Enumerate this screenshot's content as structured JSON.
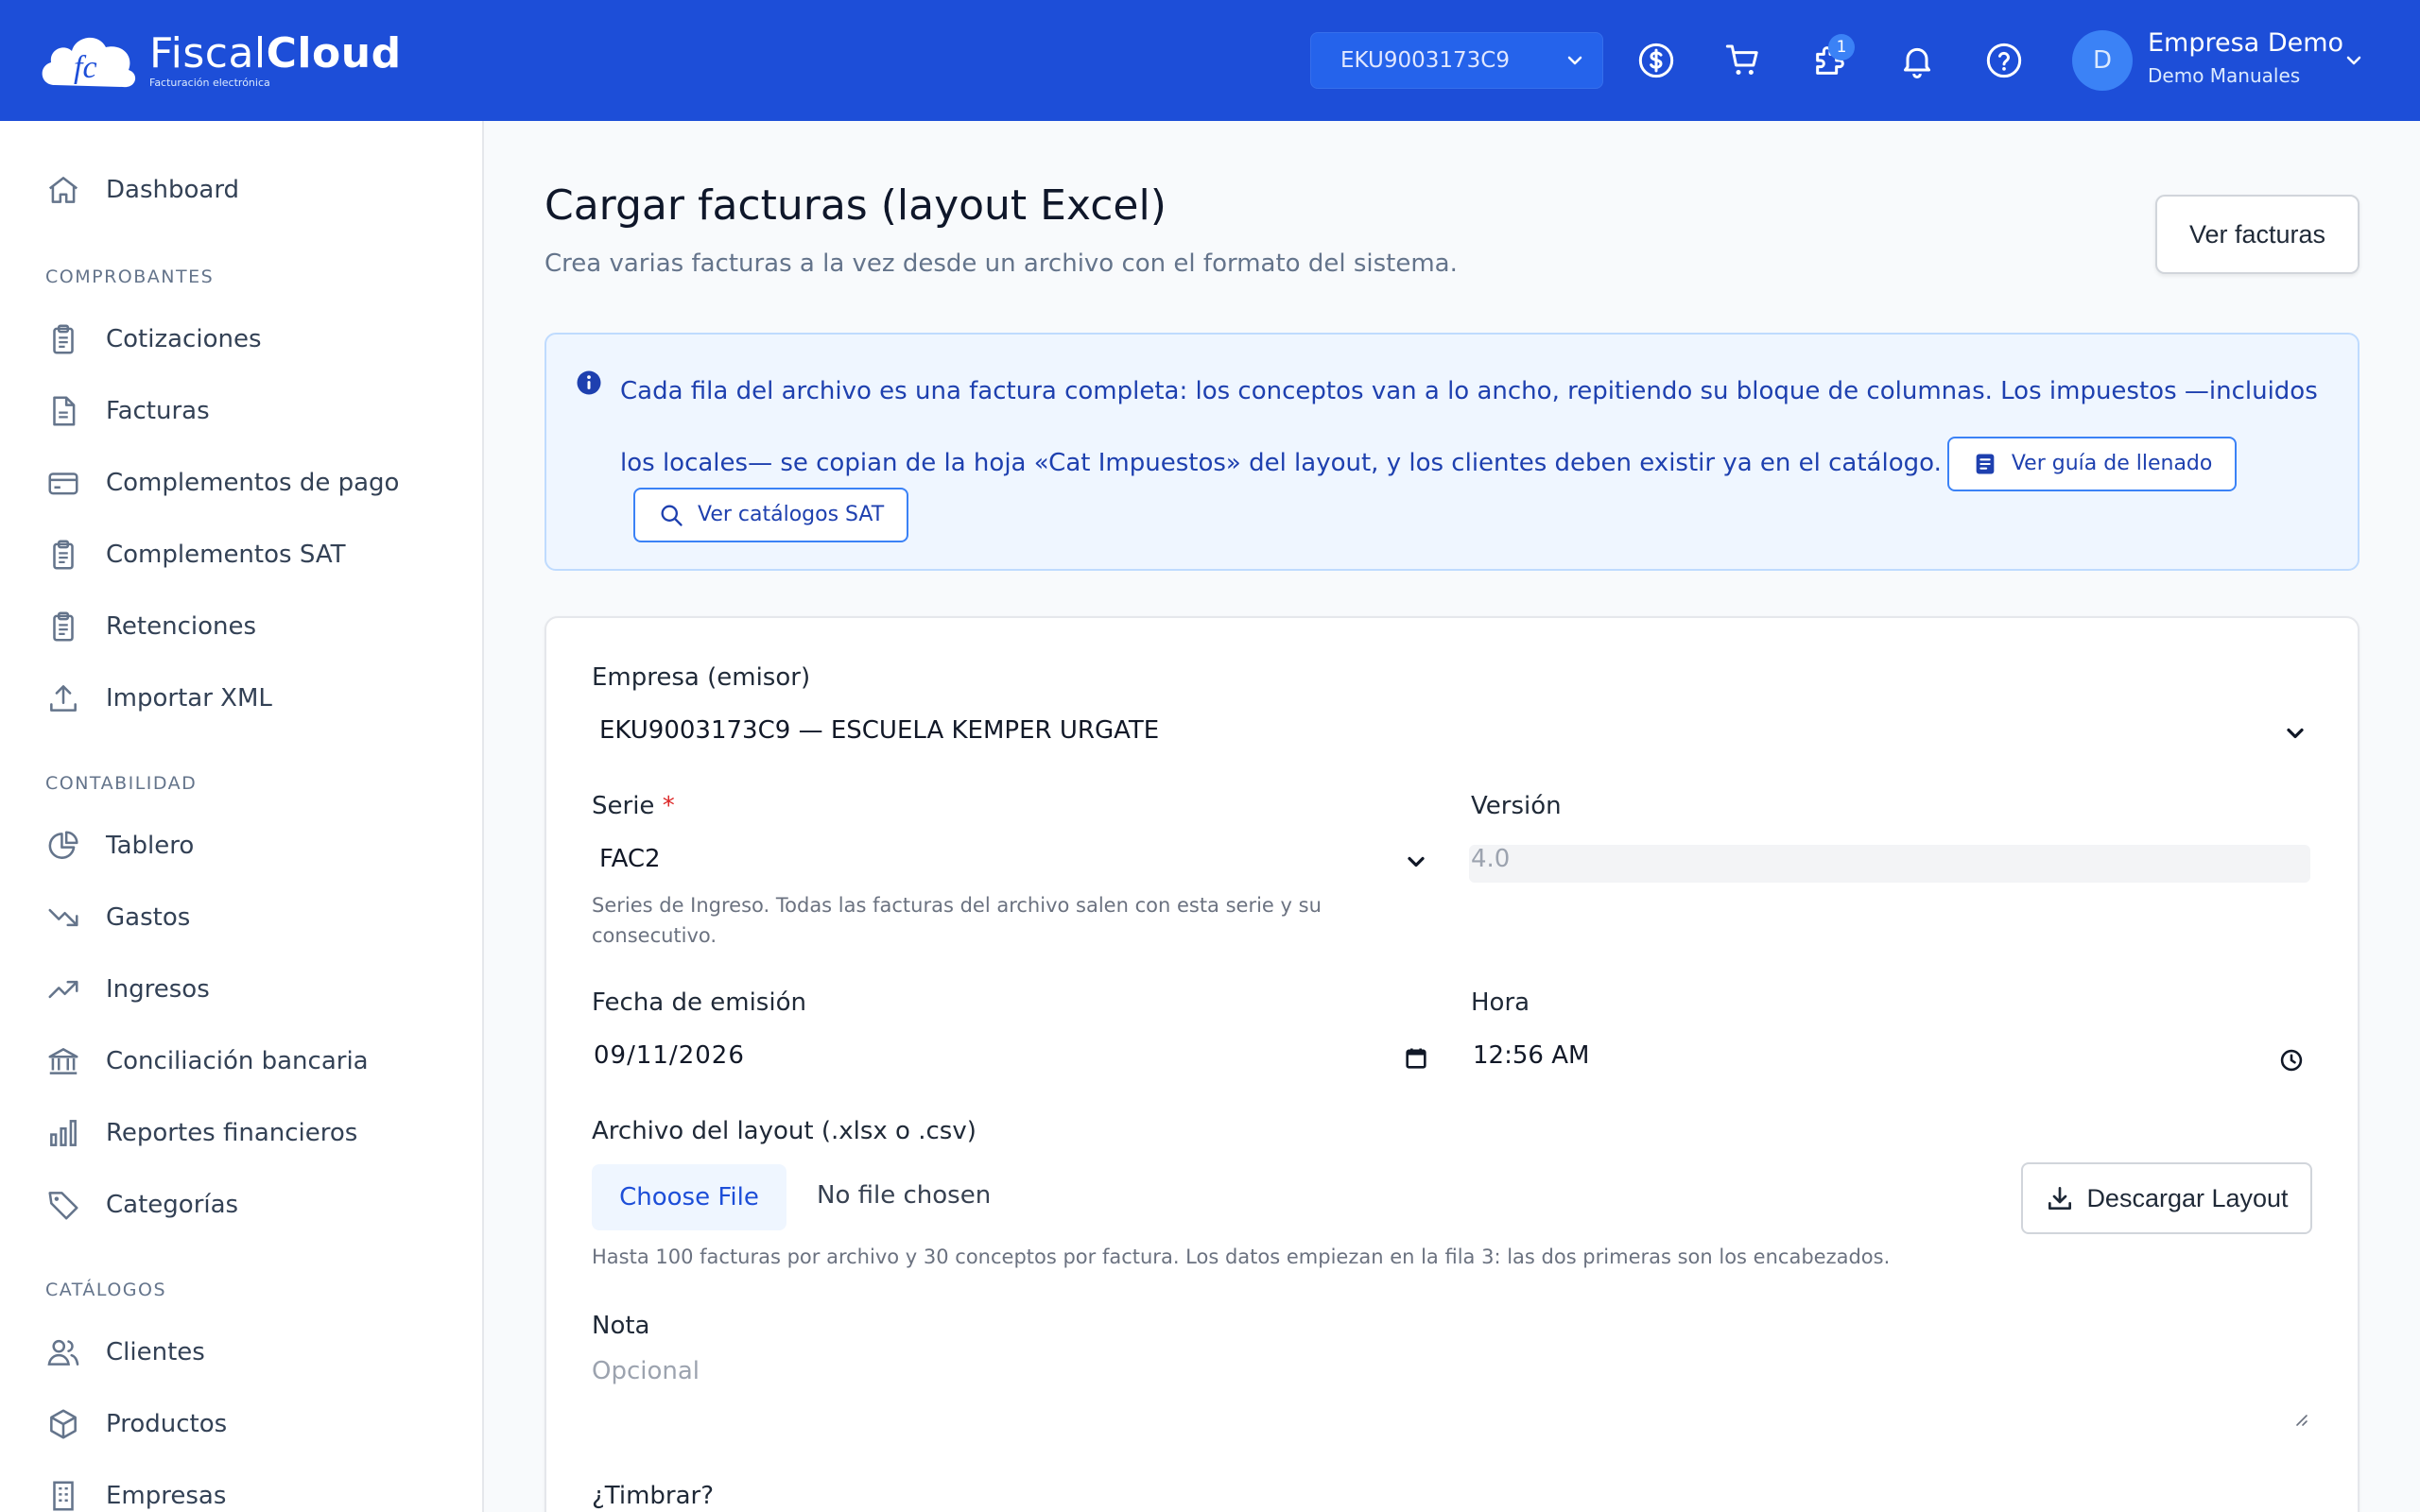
{
  "header": {
    "logo_name_light": "Fiscal",
    "logo_name_bold": "Cloud",
    "logo_tagline": "Facturación electrónica",
    "rfc_selected": "EKU9003173C9",
    "notifications_badge": "1",
    "icons": [
      "dollar-icon",
      "cart-icon",
      "puzzle-icon",
      "bell-icon",
      "help-icon",
      "chevron-down-icon"
    ],
    "user_initial": "D",
    "user_name": "Empresa Demo",
    "user_sub": "Demo Manuales"
  },
  "sidebar": {
    "dashboard": "Dashboard",
    "section_comprobantes": "COMPROBANTES",
    "comprobantes": [
      "Cotizaciones",
      "Facturas",
      "Complementos de pago",
      "Complementos SAT",
      "Retenciones",
      "Importar XML"
    ],
    "section_contabilidad": "CONTABILIDAD",
    "contabilidad": [
      "Tablero",
      "Gastos",
      "Ingresos",
      "Conciliación bancaria",
      "Reportes financieros",
      "Categorías"
    ],
    "section_catalogos": "CATÁLOGOS",
    "catalogos": [
      "Clientes",
      "Productos",
      "Empresas"
    ]
  },
  "page": {
    "title": "Cargar facturas (layout Excel)",
    "subtitle": "Crea varias facturas a la vez desde un archivo con el formato del sistema.",
    "ver_facturas": "Ver facturas"
  },
  "info": {
    "text": "Cada fila del archivo es una factura completa: los conceptos van a lo ancho, repitiendo su bloque de columnas. Los impuestos —incluidos los locales— se copian de la hoja «Cat Impuestos» del layout, y los clientes deben existir ya en el catálogo.",
    "guide_button": "Ver guía de llenado",
    "catalog_button": "Ver catálogos SAT"
  },
  "form": {
    "empresa_label": "Empresa (emisor)",
    "empresa_value": "EKU9003173C9 — ESCUELA KEMPER URGATE",
    "serie_label": "Serie",
    "serie_required": "*",
    "serie_value": "FAC2",
    "serie_help": "Series de Ingreso. Todas las facturas del archivo salen con esta serie y su consecutivo.",
    "version_label": "Versión",
    "version_value": "4.0",
    "fecha_label": "Fecha de emisión",
    "fecha_value": "09/11/2026",
    "hora_label": "Hora",
    "hora_value": "12:56 AM",
    "archivo_label": "Archivo del layout (.xlsx o .csv)",
    "choose_file": "Choose File",
    "no_file": "No file chosen",
    "descargar_layout": "Descargar Layout",
    "archivo_help": "Hasta 100 facturas por archivo y 30 conceptos por factura. Los datos empiezan en la fila 3: las dos primeras son los encabezados.",
    "nota_label": "Nota",
    "nota_placeholder": "Opcional",
    "timbrar_label": "¿Timbrar?"
  }
}
